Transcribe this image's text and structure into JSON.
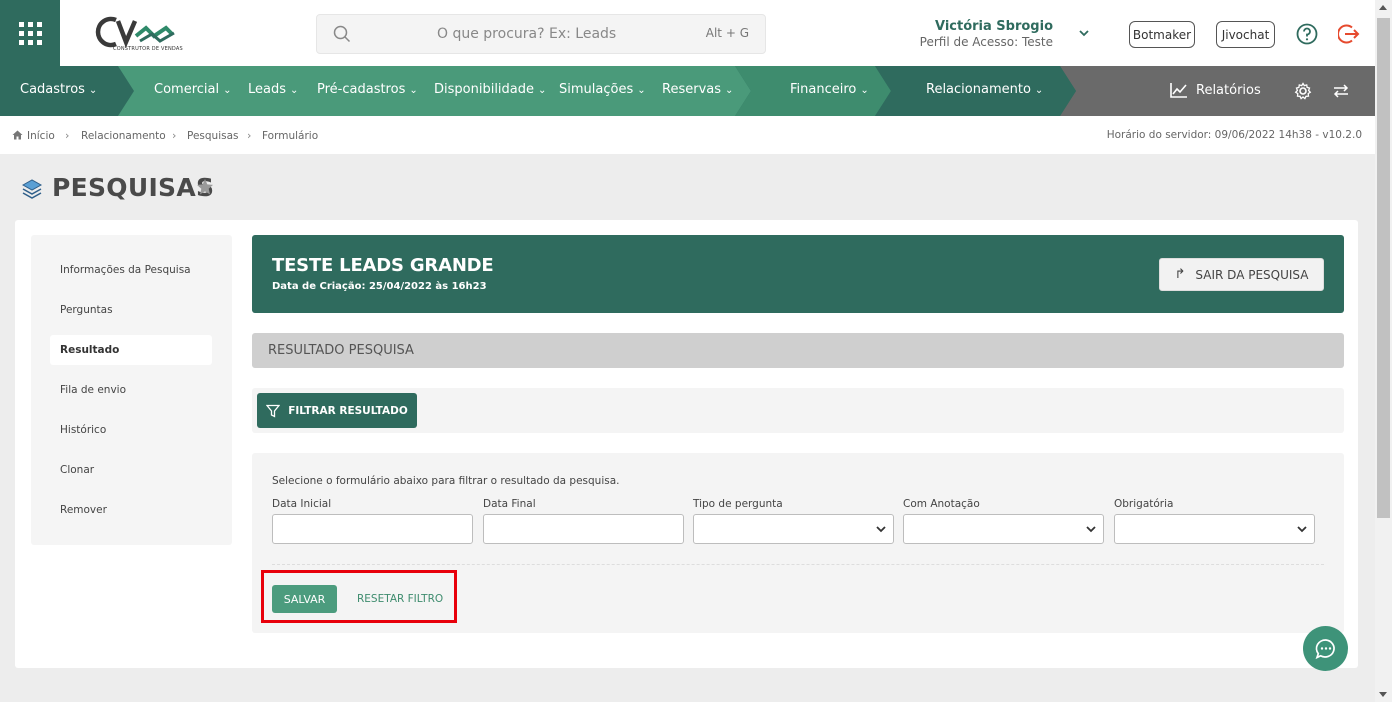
{
  "header": {
    "logo_text": "CV",
    "logo_tagline": "CONSTRUTOR DE VENDAS",
    "search": {
      "placeholder": "O que procura? Ex: Leads",
      "shortcut": "Alt + G"
    },
    "user": {
      "name": "Victória Sbrogio",
      "profile": "Perfil de Acesso: Teste"
    },
    "buttons": {
      "botmaker": "Botmaker",
      "jivochat": "Jivochat"
    },
    "icons": {
      "apps": "apps-grid-icon",
      "help": "help-icon",
      "logout": "logout-icon"
    }
  },
  "nav": {
    "cadastros": "Cadastros",
    "comercial": "Comercial",
    "leads": "Leads",
    "pre_cadastros": "Pré-cadastros",
    "disponibilidade": "Disponibilidade",
    "simulacoes": "Simulações",
    "reservas": "Reservas",
    "financeiro": "Financeiro",
    "relacionamento": "Relacionamento",
    "relatorios": "Relatórios"
  },
  "breadcrumb": {
    "items": [
      "Início",
      "Relacionamento",
      "Pesquisas",
      "Formulário"
    ],
    "server_time": "Horário do servidor: 09/06/2022 14h38 - v10.2.0"
  },
  "page": {
    "title": "PESQUISAS"
  },
  "sidebar": {
    "items": [
      {
        "label": "Informações da Pesquisa"
      },
      {
        "label": "Perguntas"
      },
      {
        "label": "Resultado"
      },
      {
        "label": "Fila de envio"
      },
      {
        "label": "Histórico"
      },
      {
        "label": "Clonar"
      },
      {
        "label": "Remover"
      }
    ]
  },
  "survey": {
    "title": "TESTE LEADS GRANDE",
    "created": "Data de Criação: 25/04/2022 às 16h23",
    "exit_label": "SAIR DA PESQUISA"
  },
  "result": {
    "heading": "RESULTADO PESQUISA",
    "filter_label": "FILTRAR RESULTADO",
    "hint": "Selecione o formulário abaixo para filtrar o resultado da pesquisa.",
    "fields": {
      "data_inicial": "Data Inicial",
      "data_final": "Data Final",
      "tipo_pergunta": "Tipo de pergunta",
      "com_anotacao": "Com Anotação",
      "obrigatoria": "Obrigatória"
    },
    "save_label": "SALVAR",
    "reset_label": "RESETAR FILTRO"
  },
  "colors": {
    "brand_green": "#2f6b5e",
    "nav_light_green": "#4a9a7a",
    "highlight_red": "#e8000b"
  }
}
